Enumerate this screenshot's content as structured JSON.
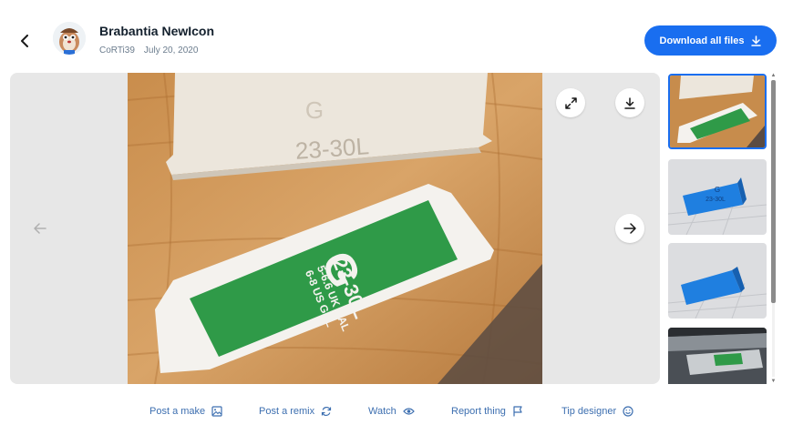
{
  "header": {
    "title": "Brabantia NewIcon",
    "author": "CoRTi39",
    "date": "July 20, 2020",
    "download_label": "Download all files"
  },
  "photo": {
    "top_label_letter": "G",
    "top_label_size": "23-30L",
    "bottom_label_letter": "G",
    "bottom_label_size": "23-30L",
    "bottom_label_uk": "5-6.6 UK GAL",
    "bottom_label_us": "6-8 US GAL"
  },
  "thumbnails": [
    {
      "name": "photo-labels",
      "active": true
    },
    {
      "name": "render-blue-label-front",
      "active": false,
      "text_letter": "G",
      "text_size": "23-30L"
    },
    {
      "name": "render-blue-label-back",
      "active": false
    },
    {
      "name": "photo-bin-installed",
      "active": false
    }
  ],
  "actions": [
    {
      "id": "post-make",
      "label": "Post a make",
      "icon": "image-icon"
    },
    {
      "id": "post-remix",
      "label": "Post a remix",
      "icon": "remix-icon"
    },
    {
      "id": "watch",
      "label": "Watch",
      "icon": "eye-icon"
    },
    {
      "id": "report",
      "label": "Report thing",
      "icon": "flag-icon"
    },
    {
      "id": "tip",
      "label": "Tip designer",
      "icon": "smile-icon"
    }
  ],
  "colors": {
    "accent": "#196ef0",
    "link": "#3d6fb0",
    "label_green": "#2f9a48"
  }
}
